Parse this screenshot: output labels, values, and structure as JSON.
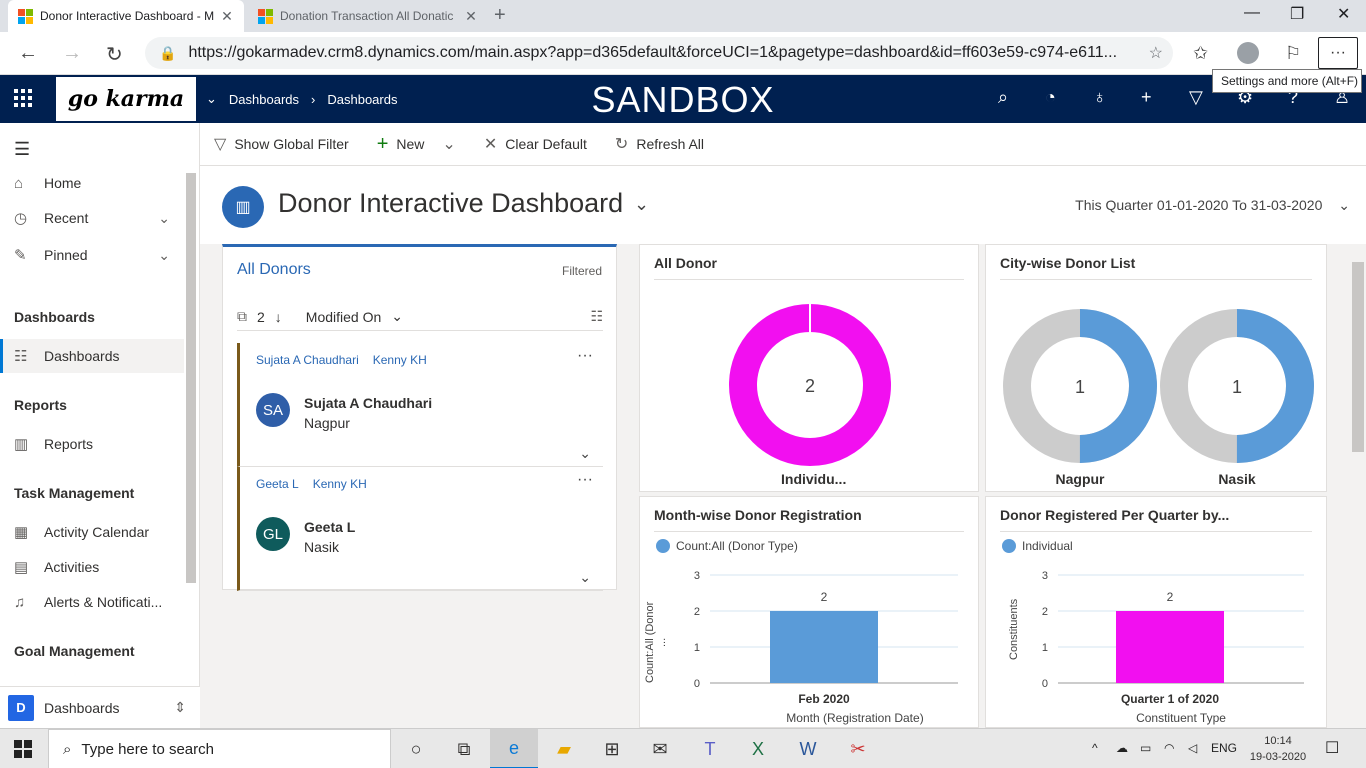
{
  "browser": {
    "tabs": [
      {
        "title": "Donor Interactive Dashboard - M",
        "active": true
      },
      {
        "title": "Donation Transaction All Donatic",
        "active": false
      }
    ],
    "url": "https://gokarmadev.crm8.dynamics.com/main.aspx?app=d365default&forceUCI=1&pagetype=dashboard&id=ff603e59-c974-e611...",
    "tooltip": "Settings and more (Alt+F)"
  },
  "header": {
    "logo_text": "go karma",
    "breadcrumb": [
      "Dashboards",
      "Dashboards"
    ],
    "env_label": "SANDBOX"
  },
  "sidebar": {
    "items": [
      {
        "label": "Home",
        "icon": "home-icon"
      },
      {
        "label": "Recent",
        "icon": "clock-icon"
      },
      {
        "label": "Pinned",
        "icon": "pin-icon"
      }
    ],
    "groups": [
      {
        "title": "Dashboards",
        "items": [
          {
            "label": "Dashboards",
            "icon": "dashboard-icon",
            "selected": true
          }
        ]
      },
      {
        "title": "Reports",
        "items": [
          {
            "label": "Reports",
            "icon": "reports-icon"
          }
        ]
      },
      {
        "title": "Task Management",
        "items": [
          {
            "label": "Activity Calendar",
            "icon": "calendar-icon"
          },
          {
            "label": "Activities",
            "icon": "clipboard-icon"
          },
          {
            "label": "Alerts & Notificati...",
            "icon": "bell-icon"
          }
        ]
      },
      {
        "title": "Goal Management",
        "items": []
      }
    ],
    "area_badge": "D",
    "area_label": "Dashboards"
  },
  "commands": {
    "show_global_filter": "Show Global Filter",
    "new": "New",
    "clear_default": "Clear Default",
    "refresh_all": "Refresh All"
  },
  "dashboard": {
    "title": "Donor Interactive Dashboard",
    "date_range": "This Quarter 01-01-2020 To 31-03-2020"
  },
  "donor_list": {
    "title": "All Donors",
    "filter_status": "Filtered",
    "count": "2",
    "sort_field": "Modified On",
    "records": [
      {
        "link1": "Sujata A Chaudhari",
        "link2": "Kenny KH",
        "initials": "SA",
        "name": "Sujata A Chaudhari",
        "city": "Nagpur",
        "color": "#2f5ea8"
      },
      {
        "link1": "Geeta L",
        "link2": "Kenny KH",
        "initials": "GL",
        "name": "Geeta L",
        "city": "Nasik",
        "color": "#0f5b5c"
      }
    ]
  },
  "charts": {
    "all_donor": {
      "title": "All Donor",
      "center": "2",
      "label": "Individu..."
    },
    "city_wise": {
      "title": "City-wise Donor List",
      "rings": [
        {
          "center": "1",
          "label": "Nagpur"
        },
        {
          "center": "1",
          "label": "Nasik"
        }
      ]
    },
    "month_wise": {
      "title": "Month-wise Donor Registration",
      "legend": "Count:All (Donor Type)",
      "ylabel": "Count:All (Donor ...",
      "xlabel": "Month (Registration Date)",
      "category": "Feb 2020",
      "value_label": "2"
    },
    "per_quarter": {
      "title": "Donor Registered Per Quarter by...",
      "legend": "Individual",
      "ylabel": "Constituents",
      "xlabel": "Constituent Type",
      "category": "Quarter 1 of 2020",
      "value_label": "2"
    }
  },
  "chart_data": [
    {
      "type": "pie",
      "title": "All Donor",
      "categories": [
        "Individu..."
      ],
      "values": [
        2
      ]
    },
    {
      "type": "pie",
      "title": "City-wise Donor List",
      "categories": [
        "Nagpur",
        "Nasik"
      ],
      "values": [
        1,
        1
      ]
    },
    {
      "type": "bar",
      "title": "Month-wise Donor Registration",
      "categories": [
        "Feb 2020"
      ],
      "series": [
        {
          "name": "Count:All (Donor Type)",
          "values": [
            2
          ]
        }
      ],
      "xlabel": "Month (Registration Date)",
      "ylabel": "Count:All (Donor ...",
      "ylim": [
        0,
        3
      ],
      "yticks": [
        "0",
        "1",
        "2",
        "3"
      ]
    },
    {
      "type": "bar",
      "title": "Donor Registered Per Quarter by...",
      "categories": [
        "Quarter 1 of 2020"
      ],
      "series": [
        {
          "name": "Individual",
          "values": [
            2
          ]
        }
      ],
      "xlabel": "Constituent Type",
      "ylabel": "Constituents",
      "ylim": [
        0,
        3
      ],
      "yticks": [
        "0",
        "1",
        "2",
        "3"
      ]
    }
  ],
  "colors": {
    "magenta": "#f20ff0",
    "blue": "#5a9bd8",
    "grey": "#cccccc",
    "brand_navy": "#002050"
  },
  "taskbar": {
    "search_placeholder": "Type here to search",
    "lang": "ENG",
    "time": "10:14",
    "date": "19-03-2020"
  }
}
